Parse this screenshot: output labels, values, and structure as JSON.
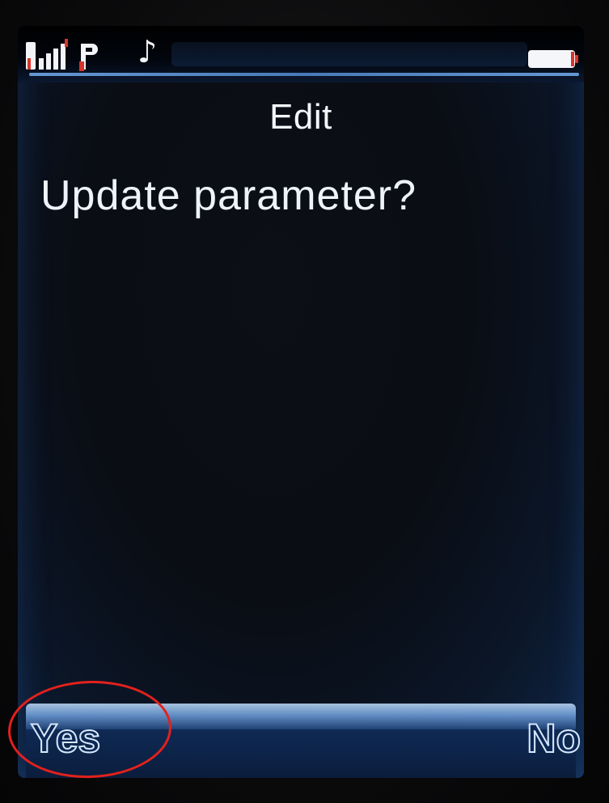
{
  "status_bar": {
    "icons": [
      "signal-strength-icon",
      "gprs-icon",
      "music-note-icon",
      "battery-icon"
    ],
    "accent_color": "#6fa6e6"
  },
  "screen": {
    "title": "Edit",
    "message": "Update parameter?"
  },
  "softkeys": {
    "left_label": "Yes",
    "right_label": "No"
  },
  "annotation": {
    "color": "#e3211d"
  }
}
